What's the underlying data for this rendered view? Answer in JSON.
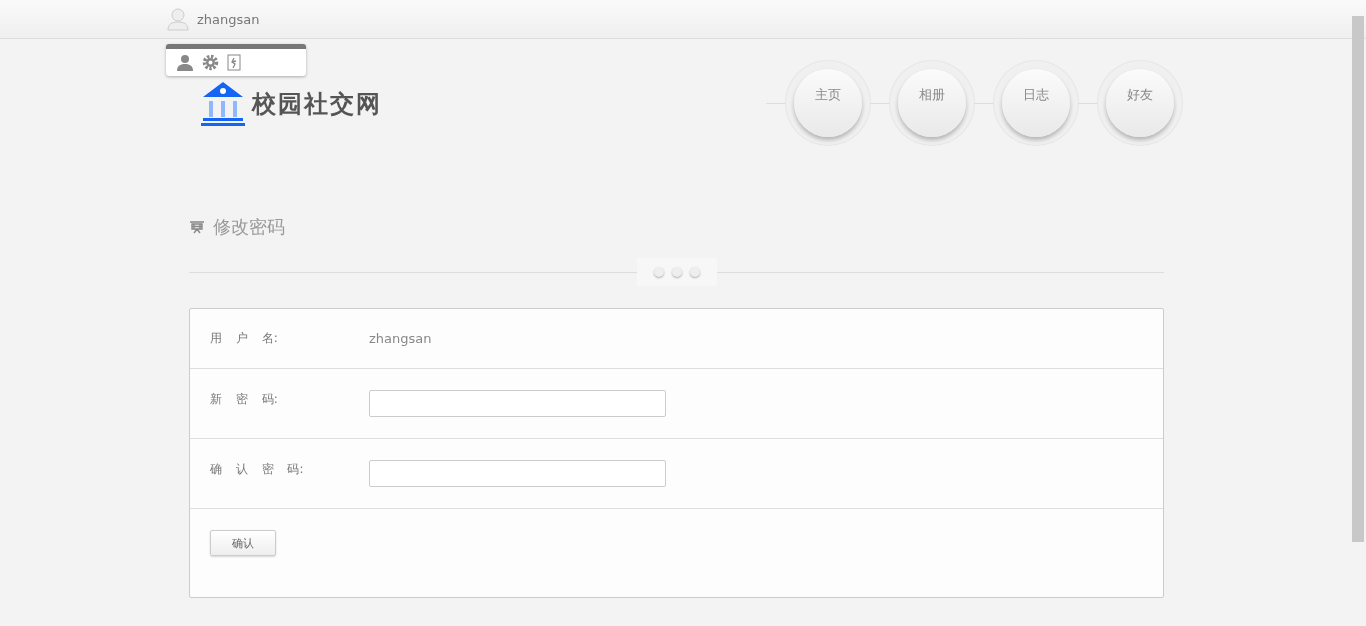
{
  "top_bar": {
    "username": "zhangsan"
  },
  "logo": {
    "text": "校园社交网"
  },
  "nav": [
    {
      "label": "主页"
    },
    {
      "label": "相册"
    },
    {
      "label": "日志"
    },
    {
      "label": "好友"
    }
  ],
  "section": {
    "title": "修改密码"
  },
  "form": {
    "rows": [
      {
        "kind": "text",
        "label": "用 户 名:",
        "value": "zhangsan"
      },
      {
        "kind": "input",
        "label": "新 密 码:"
      },
      {
        "kind": "input",
        "label": "确 认 密 码:"
      }
    ],
    "submit": "确认"
  }
}
